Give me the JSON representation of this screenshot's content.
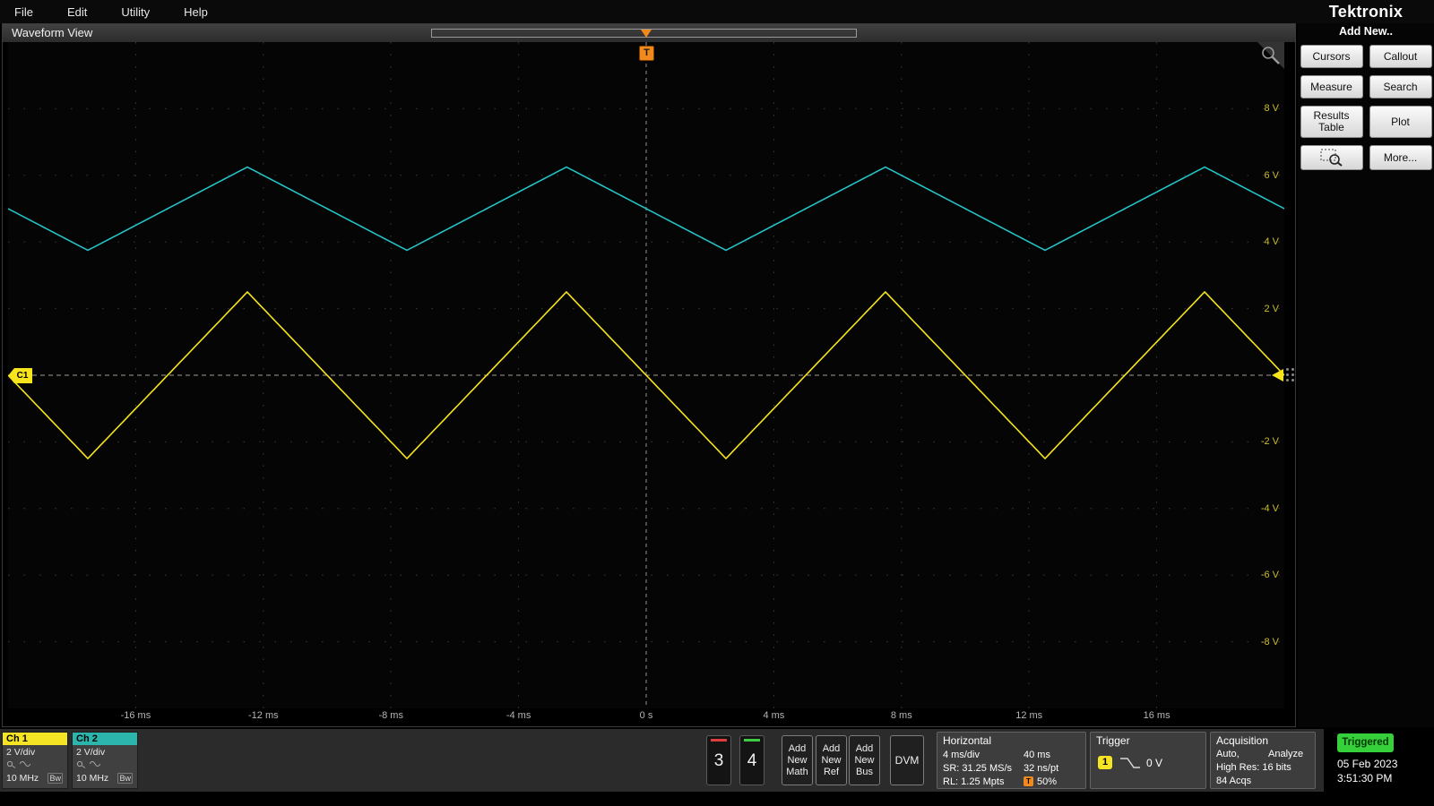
{
  "menu": {
    "items": [
      {
        "label": "File"
      },
      {
        "label": "Edit"
      },
      {
        "label": "Utility"
      },
      {
        "label": "Help"
      }
    ]
  },
  "brand": {
    "logo": "Tektronix"
  },
  "waveform_view": {
    "title": "Waveform View",
    "trigger_marker": "T",
    "ch1_marker": "C1"
  },
  "chart_data": {
    "type": "line",
    "title": "Waveform View",
    "x_axis": {
      "unit": "ms",
      "range_ms": [
        -20,
        20
      ],
      "divisions": 10,
      "scale": "4 ms/div",
      "tick_labels": [
        "-16 ms",
        "-12 ms",
        "-8 ms",
        "-4 ms",
        "0 s",
        "4 ms",
        "8 ms",
        "12 ms",
        "16 ms"
      ],
      "tick_values_ms": [
        -16,
        -12,
        -8,
        -4,
        0,
        4,
        8,
        12,
        16
      ]
    },
    "y_axis": {
      "unit": "V",
      "range_v": [
        -10,
        10
      ],
      "divisions": 10,
      "scale": "2 V/div",
      "tick_labels": [
        "8 V",
        "6 V",
        "4 V",
        "2 V",
        "-2 V",
        "-4 V",
        "-6 V",
        "-8 V"
      ],
      "tick_values_v": [
        8,
        6,
        4,
        2,
        -2,
        -4,
        -6,
        -8
      ]
    },
    "grid": "dotted",
    "trigger": {
      "position_ms": 0,
      "level_v": 0,
      "slope": "falling"
    },
    "series": [
      {
        "name": "Ch 1",
        "color": "#f6e41c",
        "shape": "triangle",
        "period_ms": 10,
        "amplitude_v": 2.5,
        "offset_v": 0,
        "peak_times_ms": [
          -12.5,
          -2.5,
          7.5,
          17.5
        ],
        "trough_times_ms": [
          -17.5,
          -7.5,
          2.5,
          12.5
        ]
      },
      {
        "name": "Ch 2",
        "color": "#25c3c6",
        "shape": "triangle",
        "period_ms": 10,
        "amplitude_v": 1.25,
        "offset_v": 5,
        "peak_times_ms": [
          -12.5,
          -2.5,
          7.5,
          17.5
        ],
        "trough_times_ms": [
          -17.5,
          -7.5,
          2.5,
          12.5
        ]
      }
    ]
  },
  "sidebar": {
    "title": "Add New..",
    "buttons": [
      {
        "label": "Cursors"
      },
      {
        "label": "Callout"
      },
      {
        "label": "Measure"
      },
      {
        "label": "Search"
      },
      {
        "label": "Results Table"
      },
      {
        "label": "Plot"
      },
      {
        "icon": "zoom-icon"
      },
      {
        "label": "More..."
      }
    ]
  },
  "bottom_bar": {
    "ch1": {
      "name": "Ch 1",
      "scale": "2 V/div",
      "bandwidth": "10 MHz",
      "bw_badge": "Bw",
      "color": "#f5e423"
    },
    "ch2": {
      "name": "Ch 2",
      "scale": "2 V/div",
      "bandwidth": "10 MHz",
      "bw_badge": "Bw",
      "color": "#2cb5ad"
    },
    "ch3": {
      "label": "3",
      "color": "#e03c3c"
    },
    "ch4": {
      "label": "4",
      "color": "#3fcc44"
    },
    "add_buttons": [
      [
        "Add",
        "New",
        "Math"
      ],
      [
        "Add",
        "New",
        "Ref"
      ],
      [
        "Add",
        "New",
        "Bus"
      ]
    ],
    "dvm": "DVM",
    "horizontal": {
      "title": "Horizontal",
      "scale": "4 ms/div",
      "window": "40 ms",
      "sample_rate": "SR: 31.25 MS/s",
      "resolution": "32 ns/pt",
      "record_length": "RL: 1.25 Mpts",
      "position": "50%",
      "pos_marker": "T"
    },
    "trigger": {
      "title": "Trigger",
      "source": "1",
      "source_color": "#f5e423",
      "level": "0 V",
      "slope": "falling"
    },
    "acquisition": {
      "title": "Acquisition",
      "mode": "Auto,",
      "analyze": "Analyze",
      "detail": "High Res: 16 bits",
      "acqs": "84 Acqs"
    },
    "status": {
      "trigger_state": "Triggered",
      "trigger_state_color": "#35d03a",
      "date": "05 Feb 2023",
      "time": "3:51:30 PM"
    }
  }
}
